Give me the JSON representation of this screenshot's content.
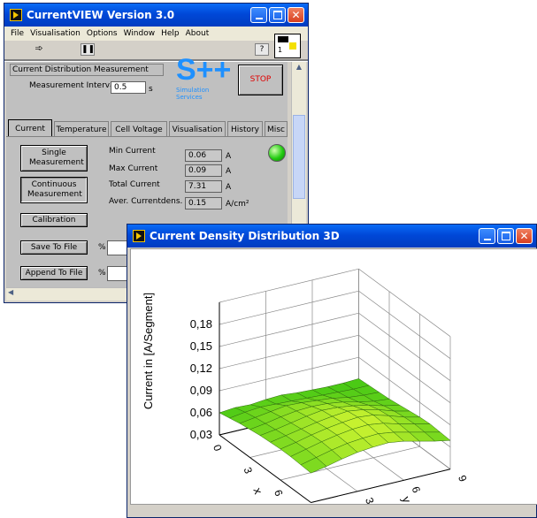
{
  "main_window": {
    "title": "CurrentVIEW Version 3.0",
    "menu": [
      "File",
      "Visualisation",
      "Options",
      "Window",
      "Help",
      "About"
    ],
    "toolbar_right_label": "1",
    "panel_title": "Current Distribution Measurement",
    "measurement_interval": {
      "label": "Measurement Interval",
      "value": "0.5",
      "unit": "s"
    },
    "logo": {
      "text": "S++",
      "subtitle": "Simulation Services"
    },
    "stop_label": "STOP",
    "tabs": [
      "Current",
      "Temperature",
      "Cell Voltage",
      "Visualisation",
      "History",
      "Misc"
    ],
    "buttons": {
      "single": "Single Measurement",
      "continuous": "Continuous Measurement",
      "calibration": "Calibration",
      "save": "Save To File",
      "append": "Append To File"
    },
    "readings": [
      {
        "label": "Min Current",
        "value": "0.06",
        "unit": "A"
      },
      {
        "label": "Max Current",
        "value": "0.09",
        "unit": "A"
      },
      {
        "label": "Total Current",
        "value": "7.31",
        "unit": "A"
      },
      {
        "label": "Aver. Currentdens.",
        "value": "0.15",
        "unit": "A/cm²"
      }
    ],
    "path_prefix": "%",
    "status_led_color": "#22cc11"
  },
  "plot_window": {
    "title": "Current Density Distribution 3D"
  },
  "chart_data": {
    "type": "surface",
    "zlabel": "Current in [A/Segment]",
    "xlabel": "x",
    "ylabel": "y",
    "z_ticks": [
      "0,03",
      "0,06",
      "0,09",
      "0,12",
      "0,15",
      "0,18"
    ],
    "x_ticks": [
      "0",
      "3",
      "6",
      "9"
    ],
    "y_ticks": [
      "0",
      "3",
      "6",
      "9"
    ],
    "zlim": [
      0.03,
      0.18
    ],
    "x": [
      0,
      1,
      2,
      3,
      4,
      5,
      6,
      7,
      8,
      9
    ],
    "y": [
      0,
      1,
      2,
      3,
      4,
      5,
      6,
      7,
      8,
      9
    ],
    "z": [
      [
        0.06,
        0.062,
        0.061,
        0.063,
        0.064,
        0.062,
        0.061,
        0.06,
        0.06,
        0.061
      ],
      [
        0.063,
        0.066,
        0.068,
        0.067,
        0.066,
        0.065,
        0.064,
        0.063,
        0.062,
        0.062
      ],
      [
        0.066,
        0.069,
        0.072,
        0.075,
        0.074,
        0.072,
        0.07,
        0.066,
        0.064,
        0.063
      ],
      [
        0.068,
        0.071,
        0.075,
        0.078,
        0.079,
        0.078,
        0.075,
        0.07,
        0.066,
        0.064
      ],
      [
        0.07,
        0.073,
        0.077,
        0.081,
        0.084,
        0.083,
        0.08,
        0.076,
        0.07,
        0.066
      ],
      [
        0.071,
        0.075,
        0.079,
        0.083,
        0.086,
        0.088,
        0.085,
        0.08,
        0.073,
        0.068
      ],
      [
        0.072,
        0.076,
        0.081,
        0.085,
        0.088,
        0.09,
        0.088,
        0.082,
        0.075,
        0.07
      ],
      [
        0.072,
        0.077,
        0.082,
        0.086,
        0.089,
        0.09,
        0.087,
        0.081,
        0.076,
        0.071
      ],
      [
        0.071,
        0.076,
        0.081,
        0.085,
        0.087,
        0.088,
        0.085,
        0.08,
        0.075,
        0.07
      ],
      [
        0.07,
        0.074,
        0.079,
        0.083,
        0.085,
        0.086,
        0.083,
        0.078,
        0.073,
        0.069
      ]
    ]
  }
}
